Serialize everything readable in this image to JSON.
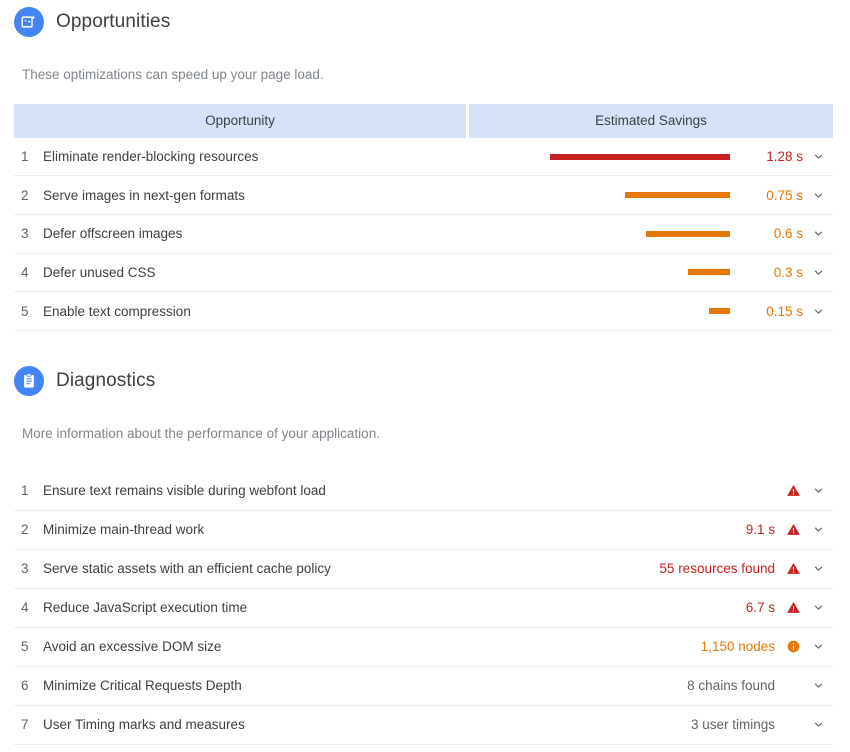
{
  "opportunities": {
    "icon": "image-plus-icon",
    "title": "Opportunities",
    "description": "These optimizations can speed up your page load.",
    "columns": {
      "name": "Opportunity",
      "savings": "Estimated Savings"
    },
    "bar_scale_seconds": 1.28,
    "rows": [
      {
        "index": "1",
        "title": "Eliminate render-blocking resources",
        "value": "1.28 s",
        "seconds": 1.28,
        "severity": "fail",
        "bar_color": "#c7221f",
        "text_color": "#c7221f"
      },
      {
        "index": "2",
        "title": "Serve images in next-gen formats",
        "value": "0.75 s",
        "seconds": 0.75,
        "severity": "average",
        "bar_color": "#e67700",
        "text_color": "#e67700"
      },
      {
        "index": "3",
        "title": "Defer offscreen images",
        "value": "0.6 s",
        "seconds": 0.6,
        "severity": "average",
        "bar_color": "#e67700",
        "text_color": "#e67700"
      },
      {
        "index": "4",
        "title": "Defer unused CSS",
        "value": "0.3 s",
        "seconds": 0.3,
        "severity": "average",
        "bar_color": "#e67700",
        "text_color": "#e67700"
      },
      {
        "index": "5",
        "title": "Enable text compression",
        "value": "0.15 s",
        "seconds": 0.15,
        "severity": "average",
        "bar_color": "#e67700",
        "text_color": "#e67700"
      }
    ]
  },
  "diagnostics": {
    "icon": "clipboard-icon",
    "title": "Diagnostics",
    "description": "More information about the performance of your application.",
    "rows": [
      {
        "index": "1",
        "title": "Ensure text remains visible during webfont load",
        "value": "",
        "status_icon": "warning-triangle-icon",
        "status_color": "#c7221f",
        "text_color": "#c7221f"
      },
      {
        "index": "2",
        "title": "Minimize main-thread work",
        "value": "9.1 s",
        "status_icon": "warning-triangle-icon",
        "status_color": "#c7221f",
        "text_color": "#c7221f"
      },
      {
        "index": "3",
        "title": "Serve static assets with an efficient cache policy",
        "value": "55 resources found",
        "status_icon": "warning-triangle-icon",
        "status_color": "#c7221f",
        "text_color": "#c7221f"
      },
      {
        "index": "4",
        "title": "Reduce JavaScript execution time",
        "value": "6.7 s",
        "status_icon": "warning-triangle-icon",
        "status_color": "#c7221f",
        "text_color": "#c7221f"
      },
      {
        "index": "5",
        "title": "Avoid an excessive DOM size",
        "value": "1,150 nodes",
        "status_icon": "info-circle-icon",
        "status_color": "#e67700",
        "text_color": "#e67700"
      },
      {
        "index": "6",
        "title": "Minimize Critical Requests Depth",
        "value": "8 chains found",
        "status_icon": "",
        "status_color": "",
        "text_color": "#5f6368"
      },
      {
        "index": "7",
        "title": "User Timing marks and measures",
        "value": "3 user timings",
        "status_icon": "",
        "status_color": "",
        "text_color": "#5f6368"
      }
    ]
  },
  "colors": {
    "header_bg": "#d6e2f7",
    "brand_blue": "#4285f4",
    "fail_red": "#c7221f",
    "average_orange": "#e67700",
    "text_dark": "#3c4043",
    "text_gray": "#5f6368",
    "divider": "#ebebeb"
  },
  "icons": {
    "chevron": "chevron-down-icon"
  }
}
